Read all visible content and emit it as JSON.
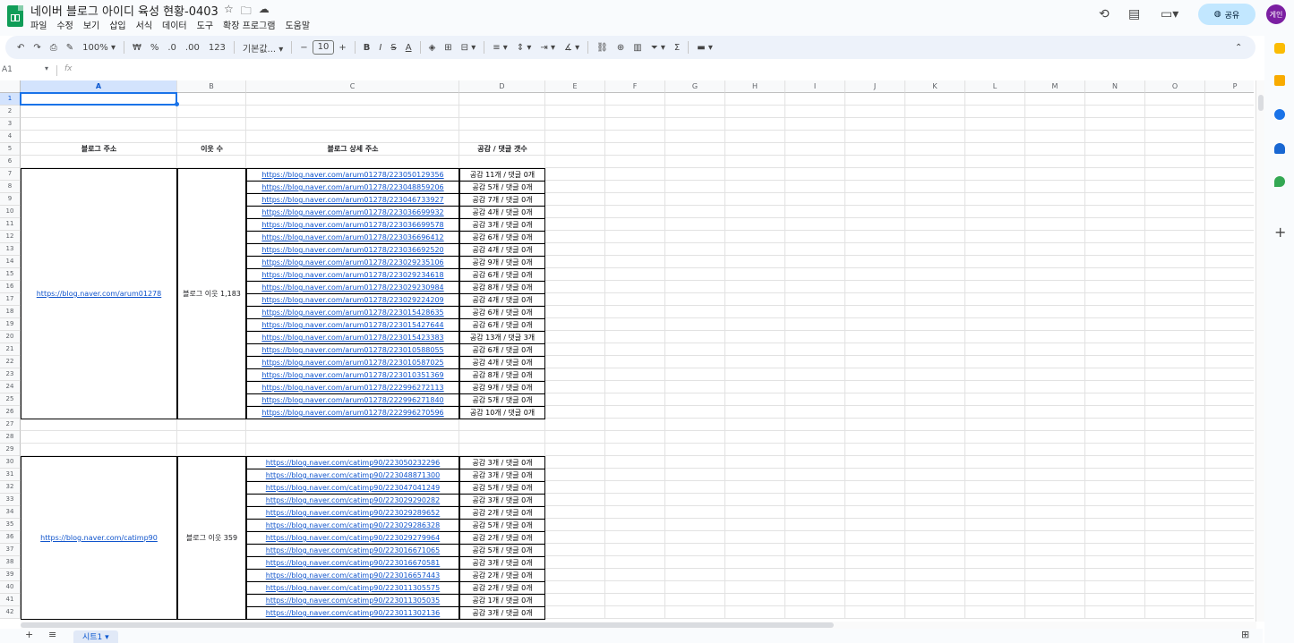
{
  "app": {
    "title": "네이버 블로그 아이디 육성 현황-0403",
    "menus": [
      "파일",
      "수정",
      "보기",
      "삽입",
      "서식",
      "데이터",
      "도구",
      "확장 프로그램",
      "도움말"
    ],
    "share_label": "공유",
    "avatar_initial": "게인"
  },
  "toolbar": {
    "zoom": "100%",
    "currency": "₩",
    "percent": "%",
    "dec_decrease": ".0",
    "dec_increase": ".00",
    "number_format": "123",
    "font_name": "기본값...",
    "font_size": "10",
    "bold": "B",
    "italic": "I",
    "strike": "S",
    "text_color": "A",
    "sum": "Σ"
  },
  "formula_bar": {
    "name_box": "A1",
    "fx": "fx"
  },
  "columns": [
    "A",
    "B",
    "C",
    "D",
    "E",
    "F",
    "G",
    "H",
    "I",
    "J",
    "K",
    "L",
    "M",
    "N",
    "O",
    "P"
  ],
  "rows": [
    "1",
    "2",
    "3",
    "4",
    "5",
    "6",
    "7",
    "8",
    "9",
    "10",
    "11",
    "12",
    "13",
    "14",
    "15",
    "16",
    "17",
    "18",
    "19",
    "20",
    "21",
    "22",
    "23",
    "24",
    "25",
    "26",
    "27",
    "28",
    "29",
    "30",
    "31",
    "32",
    "33",
    "34",
    "35",
    "36",
    "37",
    "38",
    "39",
    "40",
    "41",
    "42"
  ],
  "headers": {
    "a": "블로그 주소",
    "b": "이웃 수",
    "c": "블로그 상세 주소",
    "d": "공감 / 댓글 갯수"
  },
  "blocks": [
    {
      "blog_url": "https://blog.naver.com/arum01278",
      "neighbors": "블로그 이웃 1,183",
      "posts": [
        {
          "url": "https://blog.naver.com/arum01278/223050129356",
          "stats": "공감 11개 / 댓글 0개"
        },
        {
          "url": "https://blog.naver.com/arum01278/223048859206",
          "stats": "공감 5개 / 댓글 0개"
        },
        {
          "url": "https://blog.naver.com/arum01278/223046733927",
          "stats": "공감 7개 / 댓글 0개"
        },
        {
          "url": "https://blog.naver.com/arum01278/223036699932",
          "stats": "공감 4개 / 댓글 0개"
        },
        {
          "url": "https://blog.naver.com/arum01278/223036699578",
          "stats": "공감 3개 / 댓글 0개"
        },
        {
          "url": "https://blog.naver.com/arum01278/223036696412",
          "stats": "공감 6개 / 댓글 0개"
        },
        {
          "url": "https://blog.naver.com/arum01278/223036692520",
          "stats": "공감 4개 / 댓글 0개"
        },
        {
          "url": "https://blog.naver.com/arum01278/223029235106",
          "stats": "공감 9개 / 댓글 0개"
        },
        {
          "url": "https://blog.naver.com/arum01278/223029234618",
          "stats": "공감 6개 / 댓글 0개"
        },
        {
          "url": "https://blog.naver.com/arum01278/223029230984",
          "stats": "공감 8개 / 댓글 0개"
        },
        {
          "url": "https://blog.naver.com/arum01278/223029224209",
          "stats": "공감 4개 / 댓글 0개"
        },
        {
          "url": "https://blog.naver.com/arum01278/223015428635",
          "stats": "공감 6개 / 댓글 0개"
        },
        {
          "url": "https://blog.naver.com/arum01278/223015427644",
          "stats": "공감 6개 / 댓글 0개"
        },
        {
          "url": "https://blog.naver.com/arum01278/223015423383",
          "stats": "공감 13개 / 댓글 3개"
        },
        {
          "url": "https://blog.naver.com/arum01278/223010588055",
          "stats": "공감 6개 / 댓글 0개"
        },
        {
          "url": "https://blog.naver.com/arum01278/223010587025",
          "stats": "공감 4개 / 댓글 0개"
        },
        {
          "url": "https://blog.naver.com/arum01278/223010351369",
          "stats": "공감 8개 / 댓글 0개"
        },
        {
          "url": "https://blog.naver.com/arum01278/222996272113",
          "stats": "공감 9개 / 댓글 0개"
        },
        {
          "url": "https://blog.naver.com/arum01278/222996271840",
          "stats": "공감 5개 / 댓글 0개"
        },
        {
          "url": "https://blog.naver.com/arum01278/222996270596",
          "stats": "공감 10개 / 댓글 0개"
        }
      ]
    },
    {
      "blog_url": "https://blog.naver.com/catimp90",
      "neighbors": "블로그 이웃 359",
      "posts": [
        {
          "url": "https://blog.naver.com/catimp90/223050232296",
          "stats": "공감 3개 / 댓글 0개"
        },
        {
          "url": "https://blog.naver.com/catimp90/223048871300",
          "stats": "공감 3개 / 댓글 0개"
        },
        {
          "url": "https://blog.naver.com/catimp90/223047041249",
          "stats": "공감 5개 / 댓글 0개"
        },
        {
          "url": "https://blog.naver.com/catimp90/223029290282",
          "stats": "공감 3개 / 댓글 0개"
        },
        {
          "url": "https://blog.naver.com/catimp90/223029289652",
          "stats": "공감 2개 / 댓글 0개"
        },
        {
          "url": "https://blog.naver.com/catimp90/223029286328",
          "stats": "공감 5개 / 댓글 0개"
        },
        {
          "url": "https://blog.naver.com/catimp90/223029279964",
          "stats": "공감 2개 / 댓글 0개"
        },
        {
          "url": "https://blog.naver.com/catimp90/223016671065",
          "stats": "공감 5개 / 댓글 0개"
        },
        {
          "url": "https://blog.naver.com/catimp90/223016670581",
          "stats": "공감 3개 / 댓글 0개"
        },
        {
          "url": "https://blog.naver.com/catimp90/223016657443",
          "stats": "공감 2개 / 댓글 0개"
        },
        {
          "url": "https://blog.naver.com/catimp90/223011305575",
          "stats": "공감 2개 / 댓글 0개"
        },
        {
          "url": "https://blog.naver.com/catimp90/223011305035",
          "stats": "공감 1개 / 댓글 0개"
        },
        {
          "url": "https://blog.naver.com/catimp90/223011302136",
          "stats": "공감 3개 / 댓글 0개"
        }
      ]
    }
  ],
  "sheet": {
    "tab_label": "시트1"
  },
  "colors": {
    "link": "#1155cc",
    "accent": "#1a73e8",
    "share_bg": "#c2e7ff",
    "sheets_green": "#0f9d58"
  }
}
